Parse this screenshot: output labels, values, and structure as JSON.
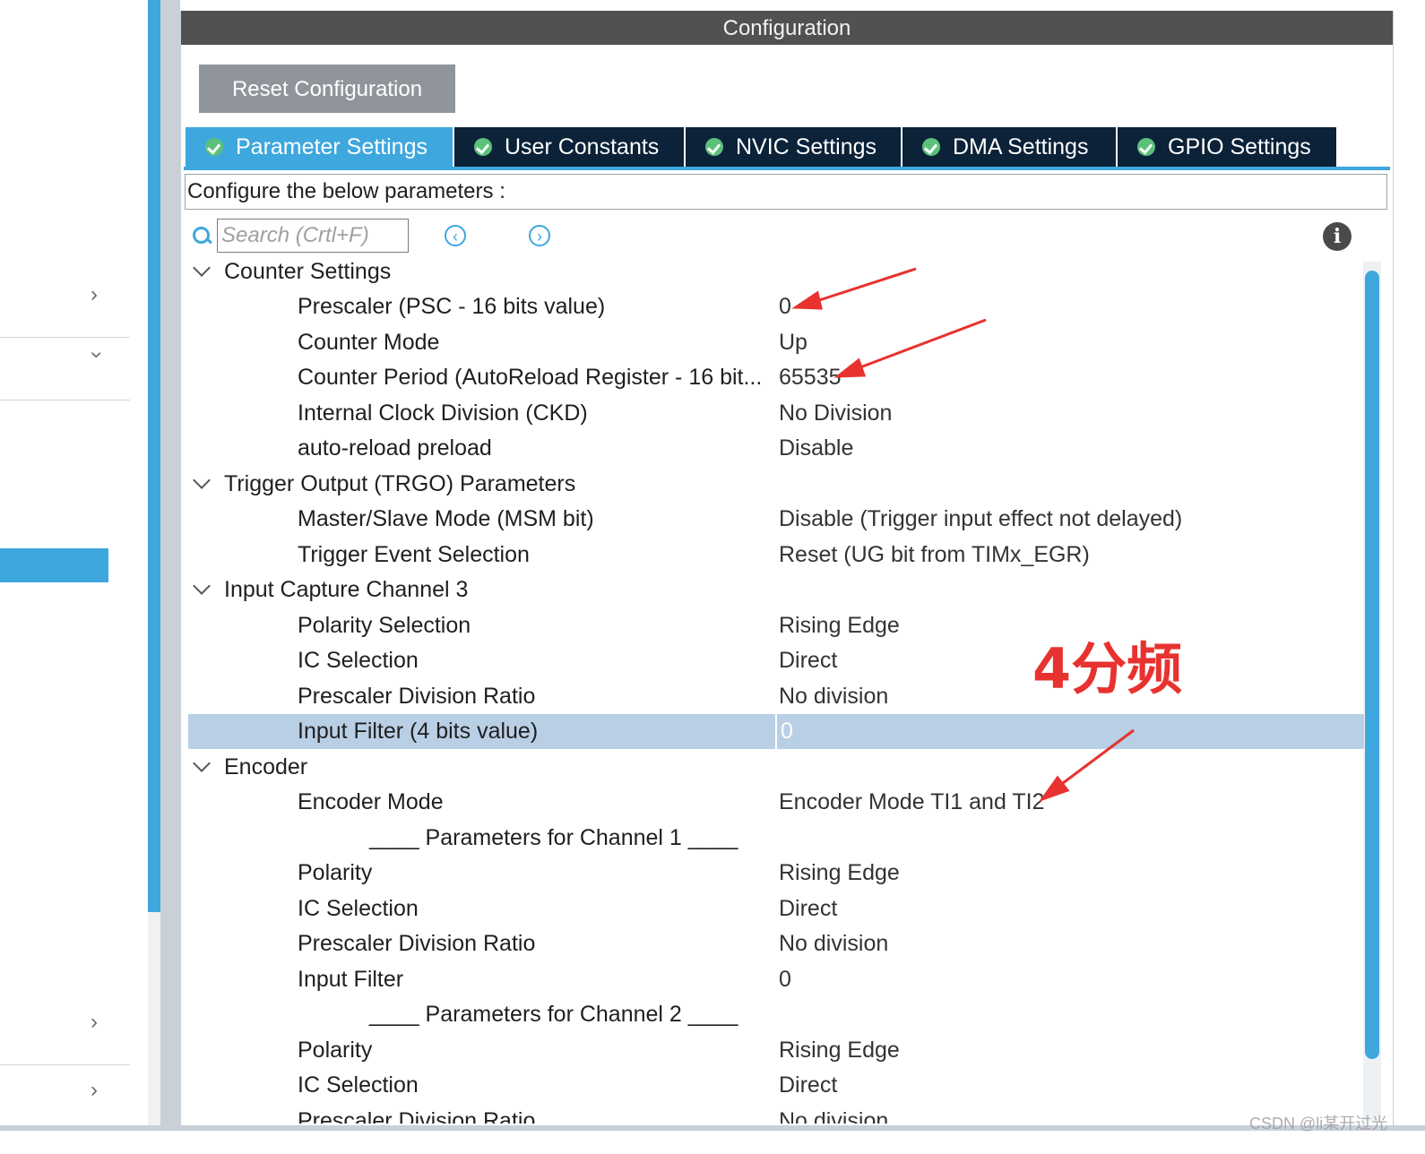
{
  "title": "Configuration",
  "reset_label": "Reset Configuration",
  "tabs": [
    {
      "label": "Parameter Settings",
      "active": true
    },
    {
      "label": "User Constants"
    },
    {
      "label": "NVIC Settings"
    },
    {
      "label": "DMA Settings"
    },
    {
      "label": "GPIO Settings"
    }
  ],
  "hint": "Configure the below parameters :",
  "search": {
    "placeholder": "Search (Crtl+F)",
    "value": ""
  },
  "groups": {
    "counter": {
      "label": "Counter Settings",
      "params": [
        {
          "label": "Prescaler (PSC - 16 bits value)",
          "value": "0"
        },
        {
          "label": "Counter Mode",
          "value": "Up"
        },
        {
          "label": "Counter Period (AutoReload Register - 16 bit...",
          "value": "65535"
        },
        {
          "label": "Internal Clock Division (CKD)",
          "value": "No Division"
        },
        {
          "label": "auto-reload preload",
          "value": "Disable"
        }
      ]
    },
    "trgo": {
      "label": "Trigger Output (TRGO) Parameters",
      "params": [
        {
          "label": "Master/Slave Mode (MSM bit)",
          "value": "Disable (Trigger input effect not delayed)"
        },
        {
          "label": "Trigger Event Selection",
          "value": "Reset (UG bit from TIMx_EGR)"
        }
      ]
    },
    "ic3": {
      "label": "Input Capture Channel 3",
      "params": [
        {
          "label": "Polarity Selection",
          "value": "Rising Edge"
        },
        {
          "label": "IC Selection",
          "value": "Direct"
        },
        {
          "label": "Prescaler Division Ratio",
          "value": "No division"
        },
        {
          "label": "Input Filter (4 bits value)",
          "value": "0"
        }
      ]
    },
    "encoder": {
      "label": "Encoder",
      "mode": {
        "label": "Encoder Mode",
        "value": "Encoder Mode TI1 and TI2"
      },
      "ch1_header": "____ Parameters for Channel 1 ____",
      "ch1": [
        {
          "label": "Polarity",
          "value": "Rising Edge"
        },
        {
          "label": "IC Selection",
          "value": "Direct"
        },
        {
          "label": "Prescaler Division Ratio",
          "value": "No division"
        },
        {
          "label": "Input Filter",
          "value": "0"
        }
      ],
      "ch2_header": "____ Parameters for Channel 2 ____",
      "ch2": [
        {
          "label": "Polarity",
          "value": "Rising Edge"
        },
        {
          "label": "IC Selection",
          "value": "Direct"
        },
        {
          "label": "Prescaler Division Ratio",
          "value": "No division"
        }
      ]
    }
  },
  "annotation": "4分频",
  "watermark": "CSDN @li某开过光",
  "colors": {
    "accent": "#3ea7dd",
    "tab_dark": "#0b2239",
    "annotation": "#e8322f",
    "selected_row": "#b9cfe6"
  }
}
